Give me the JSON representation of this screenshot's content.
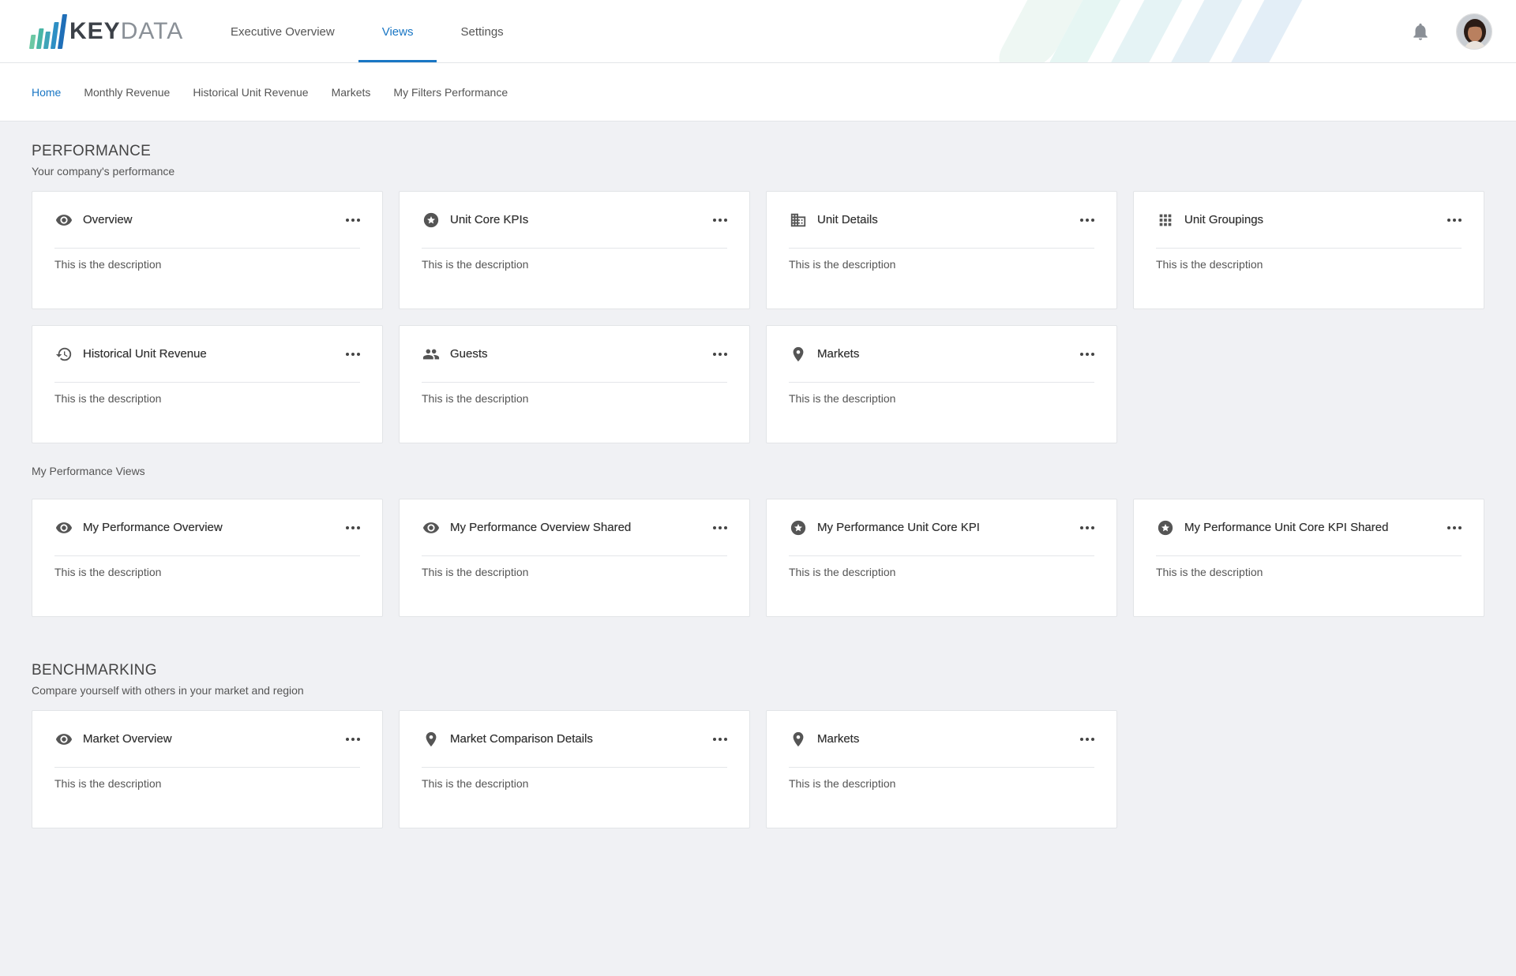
{
  "brand": {
    "key": "KEY",
    "data": "DATA"
  },
  "topnav": [
    {
      "label": "Executive Overview",
      "active": false
    },
    {
      "label": "Views",
      "active": true
    },
    {
      "label": "Settings",
      "active": false
    }
  ],
  "subnav": [
    {
      "label": "Home",
      "active": true
    },
    {
      "label": "Monthly Revenue",
      "active": false
    },
    {
      "label": "Historical Unit Revenue",
      "active": false
    },
    {
      "label": "Markets",
      "active": false
    },
    {
      "label": "My Filters Performance",
      "active": false
    }
  ],
  "performance": {
    "title": "PERFORMANCE",
    "subtitle": "Your company's performance",
    "cards": [
      {
        "title": "Overview",
        "icon": "eye-icon",
        "description": "This is the description"
      },
      {
        "title": "Unit Core KPIs",
        "icon": "star-circle-icon",
        "description": "This is the description"
      },
      {
        "title": "Unit Details",
        "icon": "building-icon",
        "description": "This is the description"
      },
      {
        "title": "Unit Groupings",
        "icon": "grid-icon",
        "description": "This is the description"
      },
      {
        "title": "Historical Unit Revenue",
        "icon": "history-icon",
        "description": "This is the description"
      },
      {
        "title": "Guests",
        "icon": "people-icon",
        "description": "This is the description"
      },
      {
        "title": "Markets",
        "icon": "location-pin-icon",
        "description": "This is the description"
      }
    ],
    "my_views_label": "My Performance Views",
    "my_views": [
      {
        "title": "My Performance Overview",
        "icon": "eye-icon",
        "description": "This is the description"
      },
      {
        "title": "My Performance Overview Shared",
        "icon": "eye-icon",
        "description": "This is the description"
      },
      {
        "title": "My Performance Unit Core KPI",
        "icon": "star-circle-icon",
        "description": "This is the description"
      },
      {
        "title": "My Performance Unit Core KPI Shared",
        "icon": "star-circle-icon",
        "description": "This is the description"
      }
    ]
  },
  "benchmarking": {
    "title": "BENCHMARKING",
    "subtitle": "Compare yourself with others in your market and region",
    "cards": [
      {
        "title": "Market Overview",
        "icon": "eye-icon",
        "description": "This is the description"
      },
      {
        "title": "Market Comparison Details",
        "icon": "location-pin-icon",
        "description": "This is the description"
      },
      {
        "title": "Markets",
        "icon": "location-pin-icon",
        "description": "This is the description"
      }
    ]
  },
  "colors": {
    "accent": "#1976c4",
    "background": "#f0f1f4",
    "icon": "#555555"
  }
}
